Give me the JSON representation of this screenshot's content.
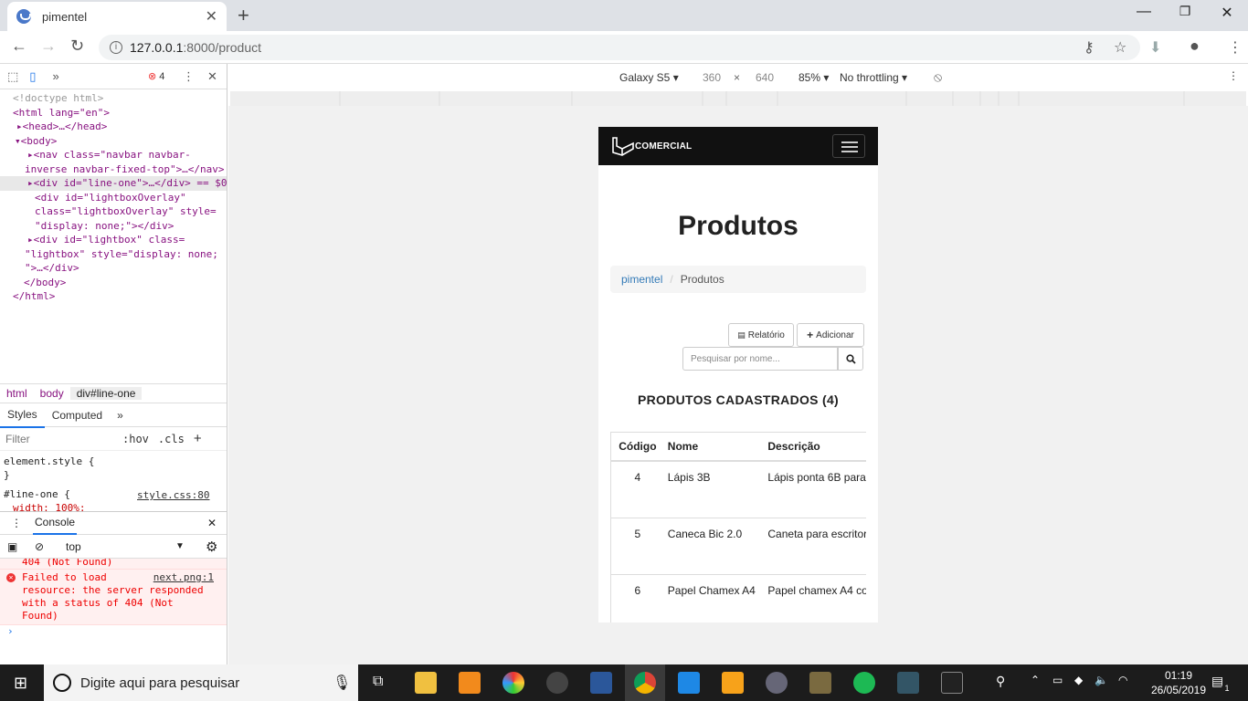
{
  "browser": {
    "tab_title": "pimentel",
    "url_host": "127.0.0.1",
    "url_path": ":8000/product"
  },
  "devtools": {
    "error_count": "4",
    "dom_lines": [
      {
        "t": "<!doctype html>"
      },
      {
        "t": "<html lang=\"en\">"
      },
      {
        "t": "▸<head>…</head>"
      },
      {
        "t": "▾<body>"
      },
      {
        "t": "▸<nav class=\"navbar navbar-"
      },
      {
        "t": "inverse navbar-fixed-top\">…</nav>"
      },
      {
        "t": "▸<div id=\"line-one\">…</div> == $0"
      },
      {
        "t": "<div id=\"lightboxOverlay\""
      },
      {
        "t": "class=\"lightboxOverlay\" style="
      },
      {
        "t": "\"display: none;\"></div>"
      },
      {
        "t": "▸<div id=\"lightbox\" class="
      },
      {
        "t": "\"lightbox\" style=\"display: none;"
      },
      {
        "t": "\">…</div>"
      },
      {
        "t": "</body>"
      },
      {
        "t": "</html>"
      }
    ],
    "crumbs": [
      "html",
      "body",
      "div#line-one"
    ],
    "style_tabs": [
      "Styles",
      "Computed"
    ],
    "filter_placeholder": "Filter",
    "hov": ":hov",
    "cls": ".cls",
    "styles_lines": [
      "element.style {",
      "}",
      "#line-one {",
      "  width: 100%;"
    ],
    "style_source": "style.css:80",
    "console_title": "Console",
    "console_context": "top",
    "console_prev": "404 (Not Found)",
    "console_error": "Failed to load resource: the server responded with a status of 404 (Not Found)",
    "console_error_src": "next.png:1"
  },
  "device": {
    "name": "Galaxy S5",
    "width": "360",
    "x": "×",
    "height": "640",
    "zoom": "85%",
    "throttle": "No throttling"
  },
  "site": {
    "brand": "COMERCIAL",
    "page_title": "Produtos",
    "breadcrumb": {
      "home": "pimentel",
      "sep": "/",
      "current": "Produtos"
    },
    "btn_report": "Relatório",
    "btn_add": "Adicionar",
    "search_placeholder": "Pesquisar por nome...",
    "list_title": "PRODUTOS CADASTRADOS (4)",
    "table": {
      "headers": [
        "Código",
        "Nome",
        "Descrição"
      ],
      "rows": [
        [
          "4",
          "Lápis 3B",
          "Lápis ponta 6B para"
        ],
        [
          "5",
          "Caneca Bic 2.0",
          "Caneta para escritor"
        ],
        [
          "6",
          "Papel Chamex A4",
          "Papel chamex A4 co"
        ]
      ]
    }
  },
  "taskbar": {
    "search_placeholder": "Digite aqui para pesquisar",
    "time": "01:19",
    "date": "26/05/2019",
    "notif": "1"
  }
}
